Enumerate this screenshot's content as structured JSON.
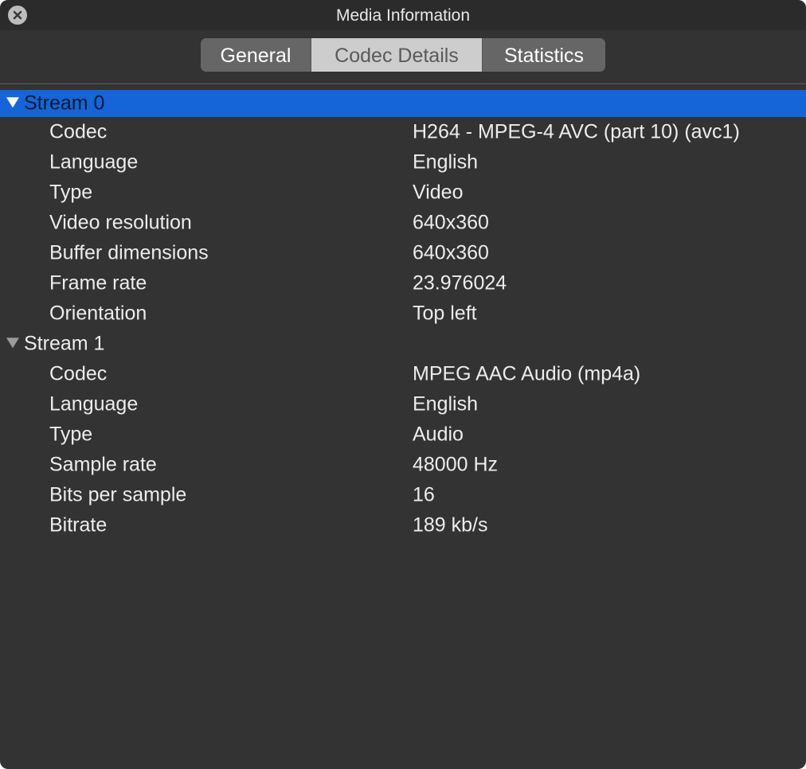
{
  "window": {
    "title": "Media Information"
  },
  "tabs": [
    {
      "label": "General",
      "selected": false
    },
    {
      "label": "Codec Details",
      "selected": true
    },
    {
      "label": "Statistics",
      "selected": false
    }
  ],
  "streams": [
    {
      "label": "Stream 0",
      "selected": true,
      "expanded": true,
      "rows": [
        {
          "key": "Codec",
          "value": "H264 - MPEG-4 AVC (part 10) (avc1)"
        },
        {
          "key": "Language",
          "value": "English"
        },
        {
          "key": "Type",
          "value": "Video"
        },
        {
          "key": "Video resolution",
          "value": "640x360"
        },
        {
          "key": "Buffer dimensions",
          "value": "640x360"
        },
        {
          "key": "Frame rate",
          "value": "23.976024"
        },
        {
          "key": "Orientation",
          "value": "Top left"
        }
      ]
    },
    {
      "label": "Stream 1",
      "selected": false,
      "expanded": true,
      "rows": [
        {
          "key": "Codec",
          "value": "MPEG AAC Audio (mp4a)"
        },
        {
          "key": "Language",
          "value": "English"
        },
        {
          "key": "Type",
          "value": "Audio"
        },
        {
          "key": "Sample rate",
          "value": "48000 Hz"
        },
        {
          "key": "Bits per sample",
          "value": "16"
        },
        {
          "key": "Bitrate",
          "value": "189 kb/s"
        }
      ]
    }
  ],
  "colors": {
    "window_bg": "#333333",
    "selection": "#1565d8",
    "selected_tab": "#cdcdcd",
    "tab_bg": "#666666"
  },
  "icons": {
    "close": "close-icon",
    "disclosure": "disclosure-triangle-icon"
  }
}
